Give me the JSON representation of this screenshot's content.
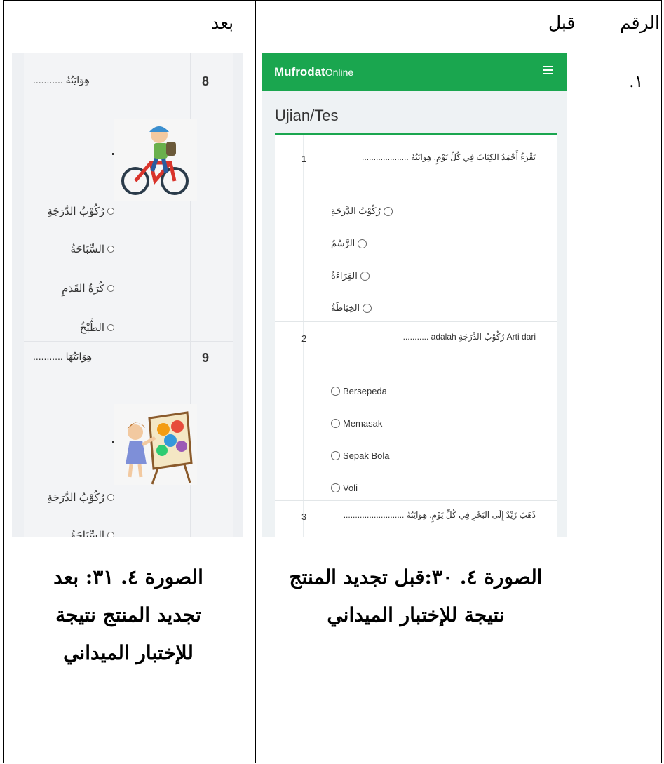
{
  "table": {
    "header_number": "الرقم",
    "header_before": "قبل",
    "header_after": "بعد",
    "row_number": ".١"
  },
  "before_panel": {
    "brand_bold": "Mufrodat",
    "brand_rest": "Online",
    "page_title": "Ujian/Tes",
    "questions": [
      {
        "number": "1",
        "text": "يَقْرَءُ أَحْمَدُ الكِتَابَ فِي كُلِّ يَوْمٍ. هِوَايَتُهُ ....................",
        "options": [
          "رُكُوْبُ الدَّرَجَةِ",
          "الرَّسْمُ",
          "القِرَاءَةُ",
          "الخِيَاطَةُ"
        ]
      },
      {
        "number": "2",
        "text": "Arti dari رُكُوْبُ الدَّرَجَةِ adalah ...........",
        "options": [
          "Bersepeda",
          "Memasak",
          "Sepak Bola",
          "Voli"
        ]
      },
      {
        "number": "3",
        "text": "ذَهَبَ زَيْدٌ إِلَى البَحْرِ فِي كُلِّ يَوْمٍ. هِوَايَتُهُ .........................."
      }
    ]
  },
  "after_panel": {
    "questions": [
      {
        "number": "8",
        "text": "هِوَايَتُهُ ...........",
        "options": [
          "رُكُوْبُ الدَّرَجَةِ",
          "السِّبَاحَةُ",
          "كُرَةُ القَدَمِ",
          "الطَّبْخُ"
        ]
      },
      {
        "number": "9",
        "text": "هِوَايَتُهَا ...........",
        "options": [
          "رُكُوْبُ الدَّرَجَةِ",
          "السِّبَاحَةُ"
        ]
      }
    ]
  },
  "captions": {
    "before": [
      "الصورة ٤. ٣٠:قبل تجديد المنتج",
      "نتيجة للإختبار الميداني"
    ],
    "after": [
      "الصورة ٤. ٣١: بعد",
      "تجديد المنتج نتيجة",
      "للإختبار الميداني"
    ]
  },
  "colors": {
    "brand_green": "#1aa64f"
  }
}
